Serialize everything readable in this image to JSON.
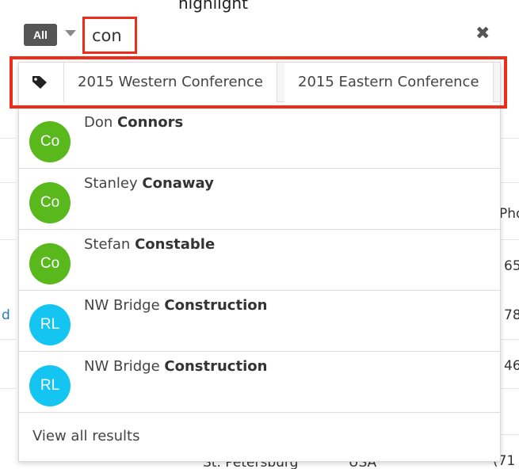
{
  "search": {
    "module_label": "All",
    "query": "con",
    "clear_icon": "times-icon"
  },
  "tags": {
    "icon": "tag-icon",
    "items": [
      "2015 Western Conference",
      "2015 Eastern Conference"
    ]
  },
  "results": [
    {
      "initials": "Co",
      "prefix": "Don ",
      "match": "Connors",
      "color": "#58b81c"
    },
    {
      "initials": "Co",
      "prefix": "Stanley ",
      "match": "Conaway",
      "color": "#58b81c"
    },
    {
      "initials": "Co",
      "prefix": "Stefan ",
      "match": "Constable",
      "color": "#58b81c"
    },
    {
      "initials": "RL",
      "prefix": "NW Bridge ",
      "match": "Construction",
      "color": "#14c5f1"
    },
    {
      "initials": "RL",
      "prefix": "NW Bridge ",
      "match": "Construction",
      "color": "#14c5f1"
    }
  ],
  "view_all_label": "View all results",
  "background": {
    "top_cut_text": "highlight",
    "col_header_partial": "Pho",
    "phone_fragments": [
      "65",
      "78",
      "46",
      "(71"
    ],
    "link_fragment": "d",
    "bottom_city": "St. Petersburg",
    "bottom_country": "USA"
  },
  "colors": {
    "annotation": "#ee2c1a",
    "contact_avatar": "#58b81c",
    "account_avatar": "#14c5f1",
    "module_button": "#555555"
  }
}
